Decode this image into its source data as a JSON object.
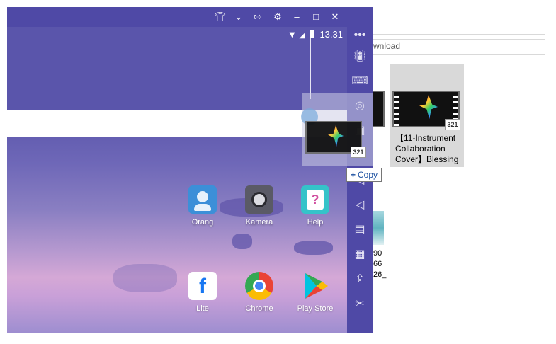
{
  "explorer": {
    "address_fragment": "wnload",
    "selected_file": {
      "name_line1": "【11-Instrument",
      "name_line2": "Collaboration",
      "name_line3": "Cover】Blessing",
      "badge": "321"
    },
    "partial_file_text": [
      "90",
      "66",
      "26_"
    ]
  },
  "emulator": {
    "status_time": "13.31",
    "titlebar_icons": [
      "shirt-icon",
      "chevron-down-icon",
      "pin-icon",
      "gear-icon",
      "minimize-icon",
      "maximize-icon",
      "close-icon"
    ],
    "apps_row1": [
      {
        "label": "Orang",
        "icon": "contacts-icon",
        "color": "#3c8fd8"
      },
      {
        "label": "Kamera",
        "icon": "camera-icon",
        "color": "#5a5a66"
      },
      {
        "label": "Help",
        "icon": "help-icon",
        "color": "#35c3c9"
      }
    ],
    "apps_row2": [
      {
        "label": "Lite",
        "icon": "facebook-icon",
        "color": "#1877f2"
      },
      {
        "label": "Chrome",
        "icon": "chrome-icon",
        "color": "#34a853"
      },
      {
        "label": "Play Store",
        "icon": "play-store-icon",
        "color": "#00c4e0"
      }
    ],
    "side_toolbar": [
      "more-icon",
      "shake-icon",
      "keyboard-icon",
      "location-icon",
      "screenshot-icon",
      "rotate-icon",
      "volume-down-icon",
      "volume-up-icon",
      "record-icon",
      "touch-icon",
      "apk-icon",
      "scissors-icon"
    ]
  },
  "drag": {
    "tooltip_symbol": "+",
    "tooltip_text": "Copy",
    "badge": "321"
  }
}
